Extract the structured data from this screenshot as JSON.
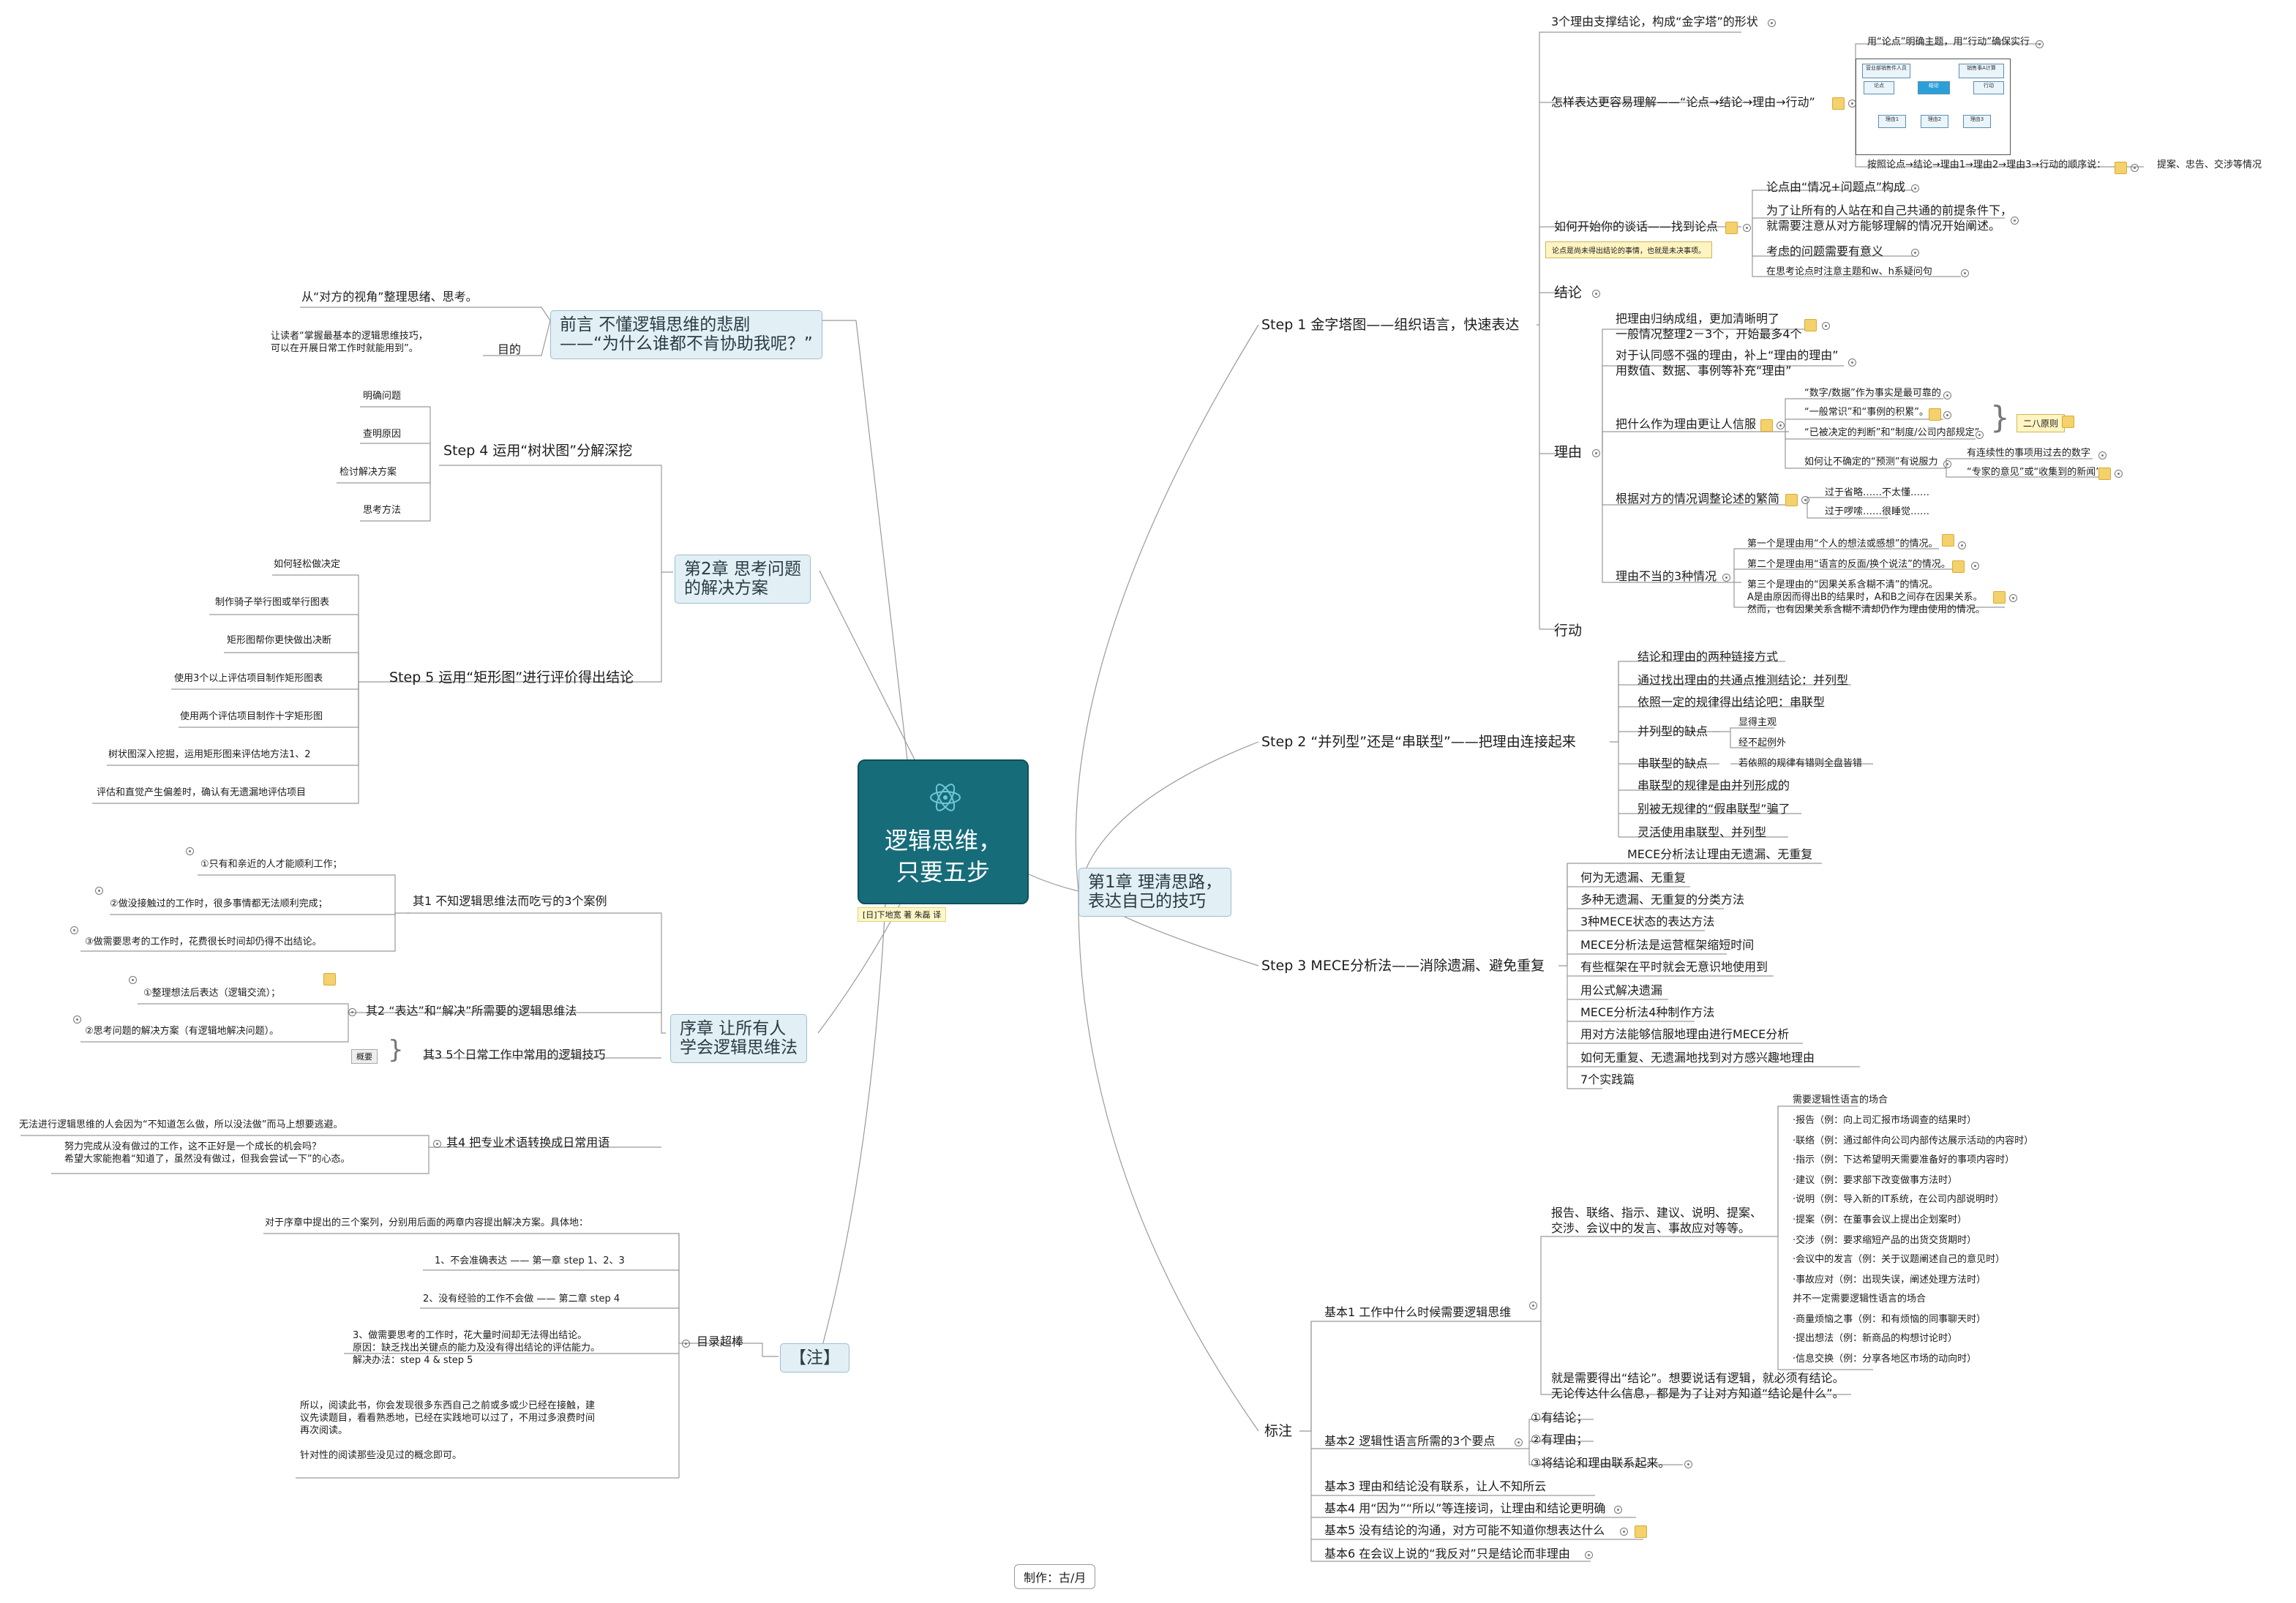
{
  "center": {
    "line1": "逻辑思维，",
    "line2": "只要五步",
    "note": "[日]下地宽 著 朱磊 译"
  },
  "maker": "制作：古/月",
  "ch1": {
    "title": "第1章  理清思路，\n表达自己的技巧",
    "s1": {
      "label": "Step 1 金字塔图——组织语言，快速表达",
      "a": "3个理由支撑结论，构成“金字塔”的形状",
      "b": "怎样表达更容易理解——“论点→结论→理由→行动”",
      "b1": "用“论点”明确主题，用“行动”确保实行",
      "b2": "按照论点→结论→理由1→理由2→理由3→行动的顺序说：",
      "b2x": "提案、忠告、交涉等情况",
      "c": "如何开始你的谈话——找到论点",
      "c1": "论点由“情况+问题点”构成",
      "c2": "为了让所有的人站在和自己共通的前提条件下，\n就需要注意从对方能够理解的情况开始阐述。",
      "c3": "考虑的问题需要有意义",
      "c4": "在思考论点时注意主题和w、h系疑问句",
      "ctag": "论点是尚未得出结论的事情，也就是未决事项。",
      "d": "结论",
      "e": "理由",
      "e1": "把理由归纳成组，更加清晰明了\n一般情况整理2－3个，开始最多4个",
      "e2": "对于认同感不强的理由，补上“理由的理由”\n用数值、数据、事例等补充“理由”",
      "e3": "把什么作为理由更让人信服",
      "e3a": "“数字/数据”作为事实是最可靠的",
      "e3b": "“一般常识”和“事例的积累”。",
      "e3c": "“已被决定的判断”和“制度/公司内部规定”",
      "e3d": "如何让不确定的“预测”有说服力",
      "e3d1": "有连续性的事项用过去的数字",
      "e3d2": "“专家的意见”或“收集到的新闻”",
      "e3tag": "二八原则",
      "e4": "根据对方的情况调整论述的繁简",
      "e4a": "过于省略……不太懂……",
      "e4b": "过于啰嗦……很睡觉……",
      "e5": "理由不当的3种情况",
      "e5a": "第一个是理由用“个人的想法或感想”的情况。",
      "e5b": "第二个是理由用“语言的反面/换个说法”的情况。",
      "e5c": "第三个是理由的“因果关系含糊不清”的情况。\nA是由原因而得出B的结果时，A和B之间存在因果关系。\n然而，也有因果关系含糊不清却仍作为理由使用的情况。",
      "f": "行动"
    },
    "s2": {
      "label": "Step 2 “并列型”还是“串联型”——把理由连接起来",
      "i": [
        "结论和理由的两种链接方式",
        "通过找出理由的共通点推测结论：并列型",
        "依照一定的规律得出结论吧：串联型",
        "并列型的缺点",
        "串联型的缺点",
        "串联型的规律是由并列形成的",
        "别被无规律的“假串联型”骗了",
        "灵活使用串联型、并列型"
      ],
      "p1": "显得主观",
      "p2": "经不起例外",
      "q1": "若依照的规律有错则全盘皆错"
    },
    "s3": {
      "label": "Step 3 MECE分析法——消除遗漏、避免重复",
      "i": [
        "MECE分析法让理由无遗漏、无重复",
        "何为无遗漏、无重复",
        "多种无遗漏、无重复的分类方法",
        "3种MECE状态的表达方法",
        "MECE分析法是运营框架缩短时间",
        "有些框架在平时就会无意识地使用到",
        "用公式解决遗漏",
        "MECE分析法4种制作方法",
        "用对方法能够信服地理由进行MECE分析",
        "如何无重复、无遗漏地找到对方感兴趣地理由",
        "7个实践篇"
      ]
    },
    "bz": {
      "label": "标注",
      "j1": "基本1   工作中什么时候需要逻辑思维",
      "j1a": "报告、联络、指示、建议、说明、提案、\n交涉、会议中的发言、事故应对等等。",
      "j1b": "就是需要得出“结论”。想要说话有逻辑，就必须有结论。\n无论传达什么信息，都是为了让对方知道“结论是什么”。",
      "list": [
        "需要逻辑性语言的场合",
        "·报告（例：向上司汇报市场调查的结果时）",
        "·联络（例：通过邮件向公司内部传达展示活动的内容时）",
        "·指示（例：下达希望明天需要准备好的事项内容时）",
        "·建议（例：要求部下改变做事方法时）",
        "·说明（例：导入新的IT系统，在公司内部说明时）",
        "·提案（例：在董事会议上提出企划案时）",
        "·交涉（例：要求缩短产品的出货交货期时）",
        "·会议中的发言（例：关于议题阐述自己的意见时）",
        "·事故应对（例：出现失误，阐述处理方法时）",
        "并不一定需要逻辑性语言的场合",
        "·商量烦恼之事（例：和有烦恼的同事聊天时）",
        "·提出想法（例：新商品的构想讨论时）",
        "·信息交换（例：分享各地区市场的动向时）"
      ],
      "j2": "基本2   逻辑性语言所需的3个要点",
      "j2a": "①有结论；",
      "j2b": "②有理由；",
      "j2c": "③将结论和理由联系起来。",
      "j3": "基本3   理由和结论没有联系，让人不知所云",
      "j4": "基本4   用“因为”“所以”等连接词，让理由和结论更明确",
      "j5": "基本5   没有结论的沟通，对方可能不知道你想表达什么",
      "j6": "基本6   在会议上说的“我反对”只是结论而非理由"
    }
  },
  "preface": {
    "title": "前言  不懂逻辑思维的悲剧\n——“为什么谁都不肯协助我呢？”",
    "a": "从“对方的视角”整理思绪、思考。",
    "b": "让读者“掌握最基本的逻辑思维技巧，\n可以在开展日常工作时就能用到”。",
    "b_lab": "目的"
  },
  "ch2": {
    "title": "第2章  思考问题\n的解决方案",
    "s4": "Step 4 运用“树状图”分解深挖",
    "s4i": [
      "明确问题",
      "查明原因",
      "检讨解决方案",
      "思考方法"
    ],
    "s5": "Step 5 运用“矩形图”进行评价得出结论",
    "s5i": [
      "如何轻松做决定",
      "制作骑子举行图或举行图表",
      "矩形图帮你更快做出决断",
      "使用3个以上评估项目制作矩形图表",
      "使用两个评估项目制作十字矩形图",
      "树状图深入挖掘，运用矩形图来评估地方法1、2",
      "评估和直觉产生偏差时，确认有无遗漏地评估项目"
    ]
  },
  "prologue": {
    "title": "序章  让所有人\n学会逻辑思维法",
    "q1": "其1  不知逻辑思维法而吃亏的3个案例",
    "q1i": [
      "①只有和亲近的人才能顺利工作；",
      "②做没接触过的工作时，很多事情都无法顺利完成；",
      "③做需要思考的工作时，花费很长时间却仍得不出结论。"
    ],
    "q2": "其2  “表达”和“解决”所需要的逻辑思维法",
    "q2i": [
      "①整理想法后表达（逻辑交流）；",
      "②思考问题的解决方案（有逻辑地解决问题）。"
    ],
    "q3": "其3 5个日常工作中常用的逻辑技巧",
    "q3tag": "概要",
    "q4": "其4  把专业术语转换成日常用语",
    "q4a": "无法进行逻辑思维的人会因为“不知道怎么做，所以没法做”而马上想要逃避。",
    "q4b": "努力完成从没有做过的工作，这不正好是一个成长的机会吗？\n希望大家能抱着“知道了，虽然没有做过，但我会尝试一下”的心态。"
  },
  "notes": {
    "title": "【注】",
    "cat": "目录超棒",
    "intro": "对于序章中提出的三个案列，分别用后面的两章内容提出解决方案。具体地：",
    "r1": "1、不会准确表达 —— 第一章 step 1、2、3",
    "r2": "2、没有经验的工作不会做 —— 第二章 step 4",
    "r3": "3、做需要思考的工作时，花大量时间却无法得出结论。\n原因：缺乏找出关键点的能力及没有得出结论的评估能力。\n解决办法：step 4 & step 5",
    "r4": "所以，阅读此书，你会发现很多东西自己之前或多或少已经在接触，建\n议先读题目，看看熟悉地，已经在实践地可以过了，不用过多浪费时间\n再次阅读。\n\n针对性的阅读那些没见过的概念即可。"
  },
  "thumb": {
    "t1": "营业部销售件人员",
    "t2": "销售事A计算",
    "c": "结论",
    "a": "论点",
    "x": "行动",
    "r1": "理由1",
    "r2": "理由2",
    "r3": "理由3"
  }
}
